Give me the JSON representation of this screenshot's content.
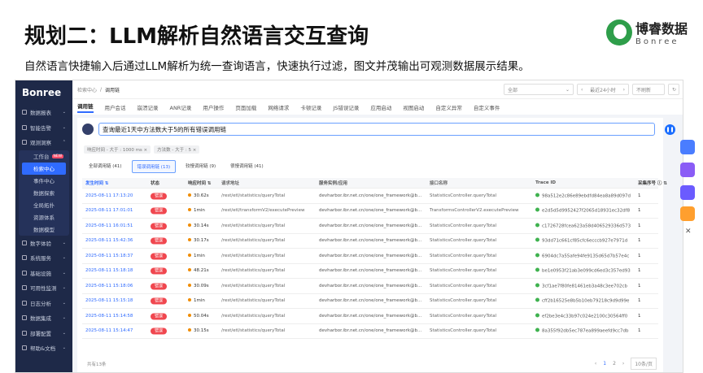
{
  "slide": {
    "title": "规划二：LLM解析自然语言交互查询",
    "subtitle": "自然语言快捷输入后通过LLM解析为统一查询语言，快速执行过滤，图文并茂输出可观测数据展示结果。",
    "logo_cn": "博睿数据",
    "logo_en": "Bonree"
  },
  "sidebar": {
    "brand": "Bonree",
    "items": [
      {
        "label": "数据报表"
      },
      {
        "label": "智能告警"
      },
      {
        "label": "观测洞察"
      }
    ],
    "sub": [
      {
        "label": "工作台",
        "badge": "NEW"
      },
      {
        "label": "检索中心"
      },
      {
        "label": "事件中心"
      },
      {
        "label": "数据探索"
      },
      {
        "label": "全局拓扑"
      },
      {
        "label": "资源体系"
      },
      {
        "label": "数据模型"
      }
    ],
    "items2": [
      {
        "label": "数字体验"
      },
      {
        "label": "系统服务"
      },
      {
        "label": "基础设施"
      },
      {
        "label": "可用性监测"
      },
      {
        "label": "日志分析"
      },
      {
        "label": "数据集成"
      },
      {
        "label": "部署配置"
      },
      {
        "label": "帮助&文档"
      }
    ]
  },
  "breadcrumb": [
    "检索中心",
    "调用链"
  ],
  "controls": {
    "app": "全部",
    "time": "最近24小时",
    "refresh": "不刷新"
  },
  "tabs": [
    "调用链",
    "用户会话",
    "崩溃记录",
    "ANR记录",
    "用户操作",
    "页面加载",
    "网络请求",
    "卡顿记录",
    "JS错误记录",
    "应用启动",
    "视图启动",
    "自定义异常",
    "自定义事件"
  ],
  "query": "查询最近1天中方法数大于5的所有错误调用链",
  "filters": [
    "响应时间 - 大于 : 1000 ms ×",
    "方法数 - 大于 : 5 ×"
  ],
  "subtabs": [
    "全部调用链 (41)",
    "错误调用链 (13)",
    "较慢调用链 (9)",
    "很慢调用链 (41)"
  ],
  "columns": [
    "发生时间 ⇅",
    "状态",
    "响应时间 ⇅",
    "请求地址",
    "服务实例/应用",
    "接口名称",
    "Trace ID",
    "采集序号 ⓘ ⇅"
  ],
  "rows": [
    [
      "2025-08-11 17:13:20",
      "错误",
      "30.62s",
      "/rest/etl/statistics/queryTotal",
      "devharbor.ibr.net.cn/one/one_framework@b...",
      "StatisticsController.queryTotal",
      "98a512e2c86e89ebdfd84ea8a89d097d",
      "1"
    ],
    [
      "2025-08-11 17:01:01",
      "错误",
      "1min",
      "/rest/etl/transformV2/executePreview",
      "devharbor.ibr.net.cn/one/one_framework@b...",
      "TransformsControllerV2.executePreview",
      "e2d5d5d9952427f2065d18931ec32df8",
      "1"
    ],
    [
      "2025-08-11 16:01:51",
      "错误",
      "30.14s",
      "/rest/etl/statistics/queryTotal",
      "devharbor.ibr.net.cn/one/one_framework@b...",
      "StatisticsController.queryTotal",
      "c1726728fcea623a58d406529336d573",
      "1"
    ],
    [
      "2025-08-11 15:42:36",
      "错误",
      "30.17s",
      "/rest/etl/statistics/queryTotal",
      "devharbor.ibr.net.cn/one/one_framework@b...",
      "StatisticsController.queryTotal",
      "93dd71c661cf85cfc6ecccb927e7971d",
      "1"
    ],
    [
      "2025-08-11 15:18:37",
      "错误",
      "1min",
      "/rest/etl/statistics/queryTotal",
      "devharbor.ibr.net.cn/one/one_framework@b...",
      "StatisticsController.queryTotal",
      "6904dc7a55afe94fe9135d65d7b57e4c",
      "1"
    ],
    [
      "2025-08-11 15:18:18",
      "错误",
      "48.21s",
      "/rest/etl/statistics/queryTotal",
      "devharbor.ibr.net.cn/one/one_framework@b...",
      "StatisticsController.queryTotal",
      "be1e0953f21ab3e099cd6ed3c357ed93",
      "1"
    ],
    [
      "2025-08-11 15:18:06",
      "错误",
      "30.09s",
      "/rest/etl/statistics/queryTotal",
      "devharbor.ibr.net.cn/one/one_framework@b...",
      "StatisticsController.queryTotal",
      "3cf1ae7f80fe81461eb3a48c3ee702cb",
      "1"
    ],
    [
      "2025-08-11 15:15:18",
      "错误",
      "1min",
      "/rest/etl/statistics/queryTotal",
      "devharbor.ibr.net.cn/one/one_framework@b...",
      "StatisticsController.queryTotal",
      "cff2b16525e8b5b10eb79218c9d9d99e",
      "1"
    ],
    [
      "2025-08-11 15:14:58",
      "错误",
      "50.04s",
      "/rest/etl/statistics/queryTotal",
      "devharbor.ibr.net.cn/one/one_framework@b...",
      "StatisticsController.queryTotal",
      "ef2be3e4c33b97c024e2100c30564ff0",
      "1"
    ],
    [
      "2025-08-11 15:14:47",
      "错误",
      "30.15s",
      "/rest/etl/statistics/queryTotal",
      "devharbor.ibr.net.cn/one/one_framework@b...",
      "StatisticsController.queryTotal",
      "8a355f92db5ec787ea899aeefd9cc7db",
      "1"
    ]
  ],
  "footer": {
    "total": "共有13条",
    "pages": [
      "1",
      "2"
    ],
    "page_size": "10条/页"
  }
}
